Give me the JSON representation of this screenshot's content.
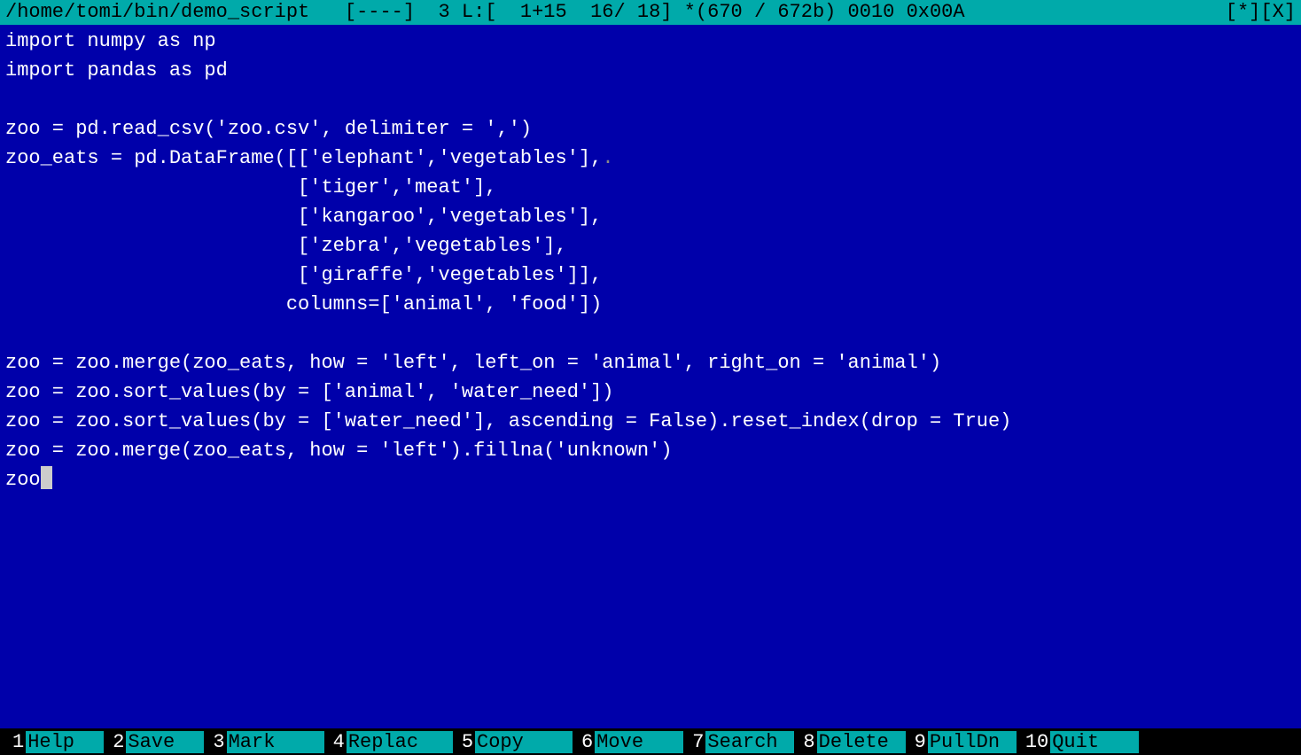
{
  "titlebar": {
    "left": "/home/tomi/bin/demo_script   [----]  3 L:[  1+15  16/ 18] *(670 / 672b) 0010 0x00A",
    "right": "[*][X]"
  },
  "code_lines": [
    "import numpy as np",
    "import pandas as pd",
    "",
    "zoo = pd.read_csv('zoo.csv', delimiter = ',')",
    "zoo_eats = pd.DataFrame([['elephant','vegetables'],",
    "                         ['tiger','meat'],",
    "                         ['kangaroo','vegetables'],",
    "                         ['zebra','vegetables'],",
    "                         ['giraffe','vegetables']],",
    "                        columns=['animal', 'food'])",
    "",
    "zoo = zoo.merge(zoo_eats, how = 'left', left_on = 'animal', right_on = 'animal')",
    "zoo = zoo.sort_values(by = ['animal', 'water_need'])",
    "zoo = zoo.sort_values(by = ['water_need'], ascending = False).reset_index(drop = True)",
    "zoo = zoo.merge(zoo_eats, how = 'left').fillna('unknown')",
    "zoo"
  ],
  "cursor_line": 15,
  "bottombar": {
    "items": [
      {
        "num": "1",
        "label": "Help"
      },
      {
        "num": "2",
        "label": "Save"
      },
      {
        "num": "3",
        "label": "Mark"
      },
      {
        "num": "4",
        "label": "Replac"
      },
      {
        "num": "5",
        "label": "Copy"
      },
      {
        "num": "6",
        "label": "Move"
      },
      {
        "num": "7",
        "label": "Search"
      },
      {
        "num": "8",
        "label": "Delete"
      },
      {
        "num": "9",
        "label": "PullDn"
      },
      {
        "num": "10",
        "label": "Quit"
      }
    ]
  }
}
